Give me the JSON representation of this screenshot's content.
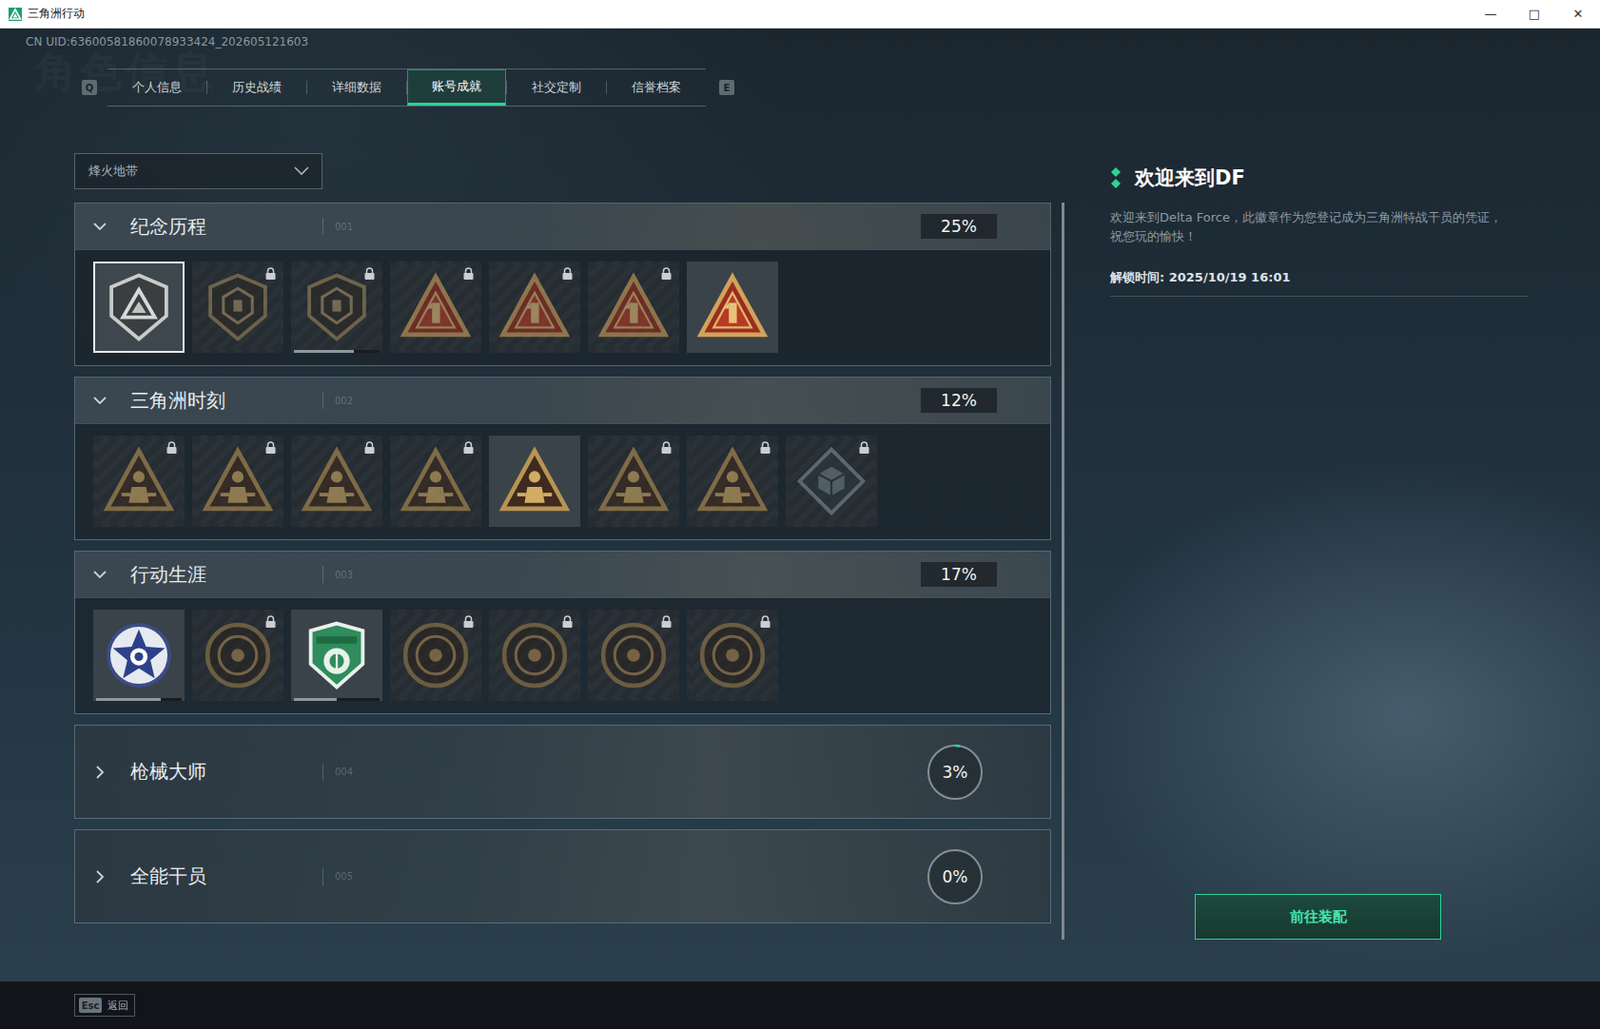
{
  "window": {
    "title": "三角洲行动",
    "controls": [
      "—",
      "□",
      "✕"
    ]
  },
  "uid": "CN UID:63600581860078933424_202605121603",
  "watermark": "角色信息",
  "tab_keys": {
    "prev": "Q",
    "next": "E"
  },
  "tabs": [
    {
      "label": "个人信息",
      "selected": false
    },
    {
      "label": "历史战绩",
      "selected": false
    },
    {
      "label": "详细数据",
      "selected": false
    },
    {
      "label": "账号成就",
      "selected": true
    },
    {
      "label": "社交定制",
      "selected": false
    },
    {
      "label": "信誉档案",
      "selected": false
    }
  ],
  "mode_select": {
    "value": "烽火地带"
  },
  "sections": [
    {
      "title": "纪念历程",
      "number": "001",
      "percent": "25%",
      "expanded": true,
      "badges": [
        {
          "kind": "shield-silver",
          "locked": false,
          "selected": true
        },
        {
          "kind": "shield",
          "locked": true,
          "selected": false
        },
        {
          "kind": "shield",
          "locked": true,
          "selected": false,
          "level": 0.7
        },
        {
          "kind": "triangle-red",
          "locked": true,
          "selected": false
        },
        {
          "kind": "triangle-red",
          "locked": true,
          "selected": false
        },
        {
          "kind": "triangle-red",
          "locked": true,
          "selected": false
        },
        {
          "kind": "triangle-red",
          "locked": false,
          "selected": false
        }
      ]
    },
    {
      "title": "三角洲时刻",
      "number": "002",
      "percent": "12%",
      "expanded": true,
      "badges": [
        {
          "kind": "triangle",
          "locked": true,
          "selected": false
        },
        {
          "kind": "triangle",
          "locked": true,
          "selected": false
        },
        {
          "kind": "triangle",
          "locked": true,
          "selected": false
        },
        {
          "kind": "triangle",
          "locked": true,
          "selected": false
        },
        {
          "kind": "triangle",
          "locked": false,
          "selected": false
        },
        {
          "kind": "triangle",
          "locked": true,
          "selected": false
        },
        {
          "kind": "triangle",
          "locked": true,
          "selected": false
        },
        {
          "kind": "diamond",
          "locked": true,
          "selected": false
        }
      ]
    },
    {
      "title": "行动生涯",
      "number": "003",
      "percent": "17%",
      "expanded": true,
      "badges": [
        {
          "kind": "medal-star",
          "locked": false,
          "selected": false,
          "level": 0.75
        },
        {
          "kind": "round",
          "locked": true,
          "selected": false
        },
        {
          "kind": "medal-green",
          "locked": false,
          "selected": false,
          "level": 0.5
        },
        {
          "kind": "round",
          "locked": true,
          "selected": false
        },
        {
          "kind": "round",
          "locked": true,
          "selected": false
        },
        {
          "kind": "round",
          "locked": true,
          "selected": false
        },
        {
          "kind": "round",
          "locked": true,
          "selected": false
        }
      ]
    },
    {
      "title": "枪械大师",
      "number": "004",
      "percent": "3%",
      "expanded": false,
      "level": 0.03,
      "badges": []
    },
    {
      "title": "全能干员",
      "number": "005",
      "percent": "0%",
      "expanded": false,
      "level": 0,
      "badges": []
    }
  ],
  "detail": {
    "title": "欢迎来到DF",
    "description": "欢迎来到Delta Force，此徽章作为您登记成为三角洲特战干员的凭证，祝您玩的愉快！",
    "unlock_time": "解锁时间: 2025/10/19 16:01",
    "button": "前往装配"
  },
  "footer": {
    "key": "Esc",
    "label": "返回"
  }
}
